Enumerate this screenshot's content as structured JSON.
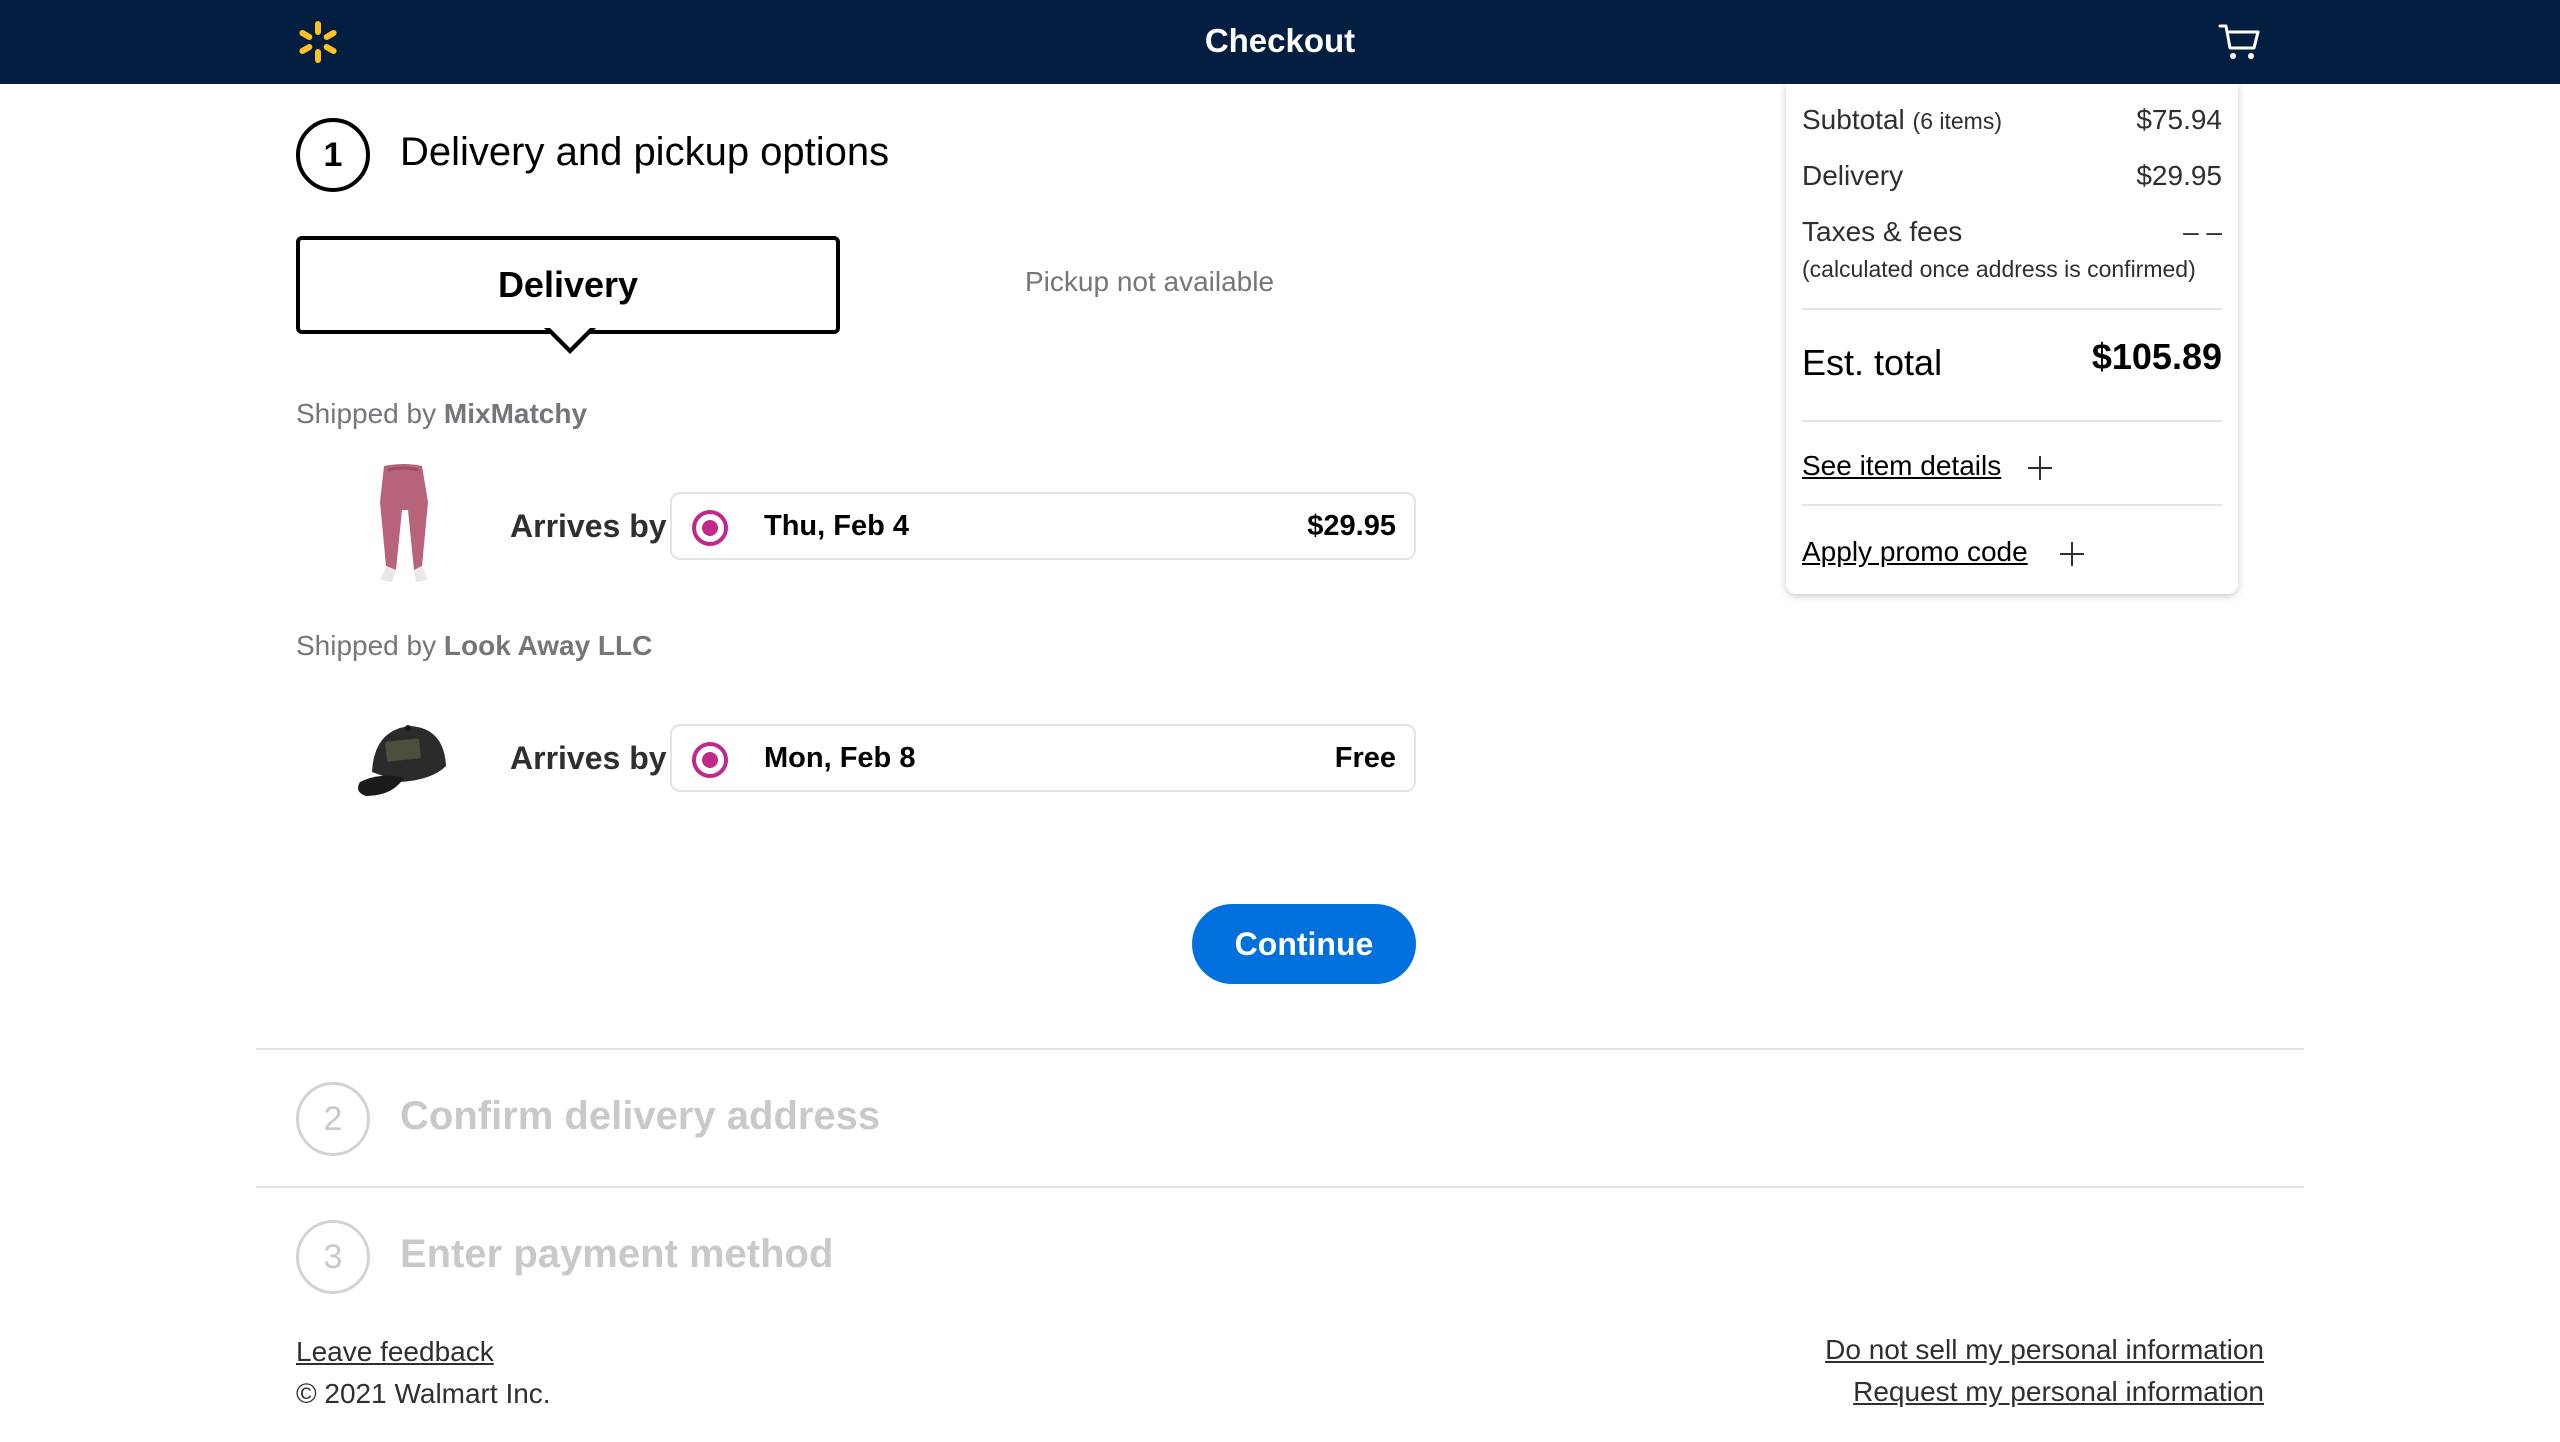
{
  "header": {
    "title": "Checkout",
    "logo_icon": "walmart-spark-icon",
    "cart_icon": "cart-icon",
    "brand_color": "#041e42",
    "spark_color": "#ffc220"
  },
  "step1": {
    "number": "1",
    "title": "Delivery and pickup options",
    "tabs": {
      "delivery": "Delivery",
      "pickup": "Pickup not available"
    },
    "shipments": [
      {
        "shipped_by_prefix": "Shipped by",
        "seller": "MixMatchy",
        "product_icon": "leggings-image",
        "arrives_label": "Arrives by",
        "date": "Thu, Feb 4",
        "price": "$29.95"
      },
      {
        "shipped_by_prefix": "Shipped by",
        "seller": "Look Away LLC",
        "product_icon": "cap-image",
        "arrives_label": "Arrives by",
        "date": "Mon, Feb 8",
        "price": "Free"
      }
    ],
    "continue_label": "Continue",
    "accent_color": "#0071dc",
    "radio_color": "#c0298a"
  },
  "step2": {
    "number": "2",
    "title": "Confirm delivery address"
  },
  "step3": {
    "number": "3",
    "title": "Enter payment method"
  },
  "summary": {
    "subtotal_label": "Subtotal",
    "subtotal_items": "(6 items)",
    "subtotal_value": "$75.94",
    "delivery_label": "Delivery",
    "delivery_value": "$29.95",
    "taxes_label": "Taxes & fees",
    "taxes_value": "– –",
    "taxes_note": "(calculated once address is confirmed)",
    "est_total_label": "Est. total",
    "est_total_value": "$105.89",
    "see_item_details": "See item details",
    "apply_promo": "Apply promo code"
  },
  "footer": {
    "leave_feedback": "Leave feedback",
    "copyright": "© 2021 Walmart Inc.",
    "do_not_sell": "Do not sell my personal information",
    "request_info": "Request my personal information"
  }
}
